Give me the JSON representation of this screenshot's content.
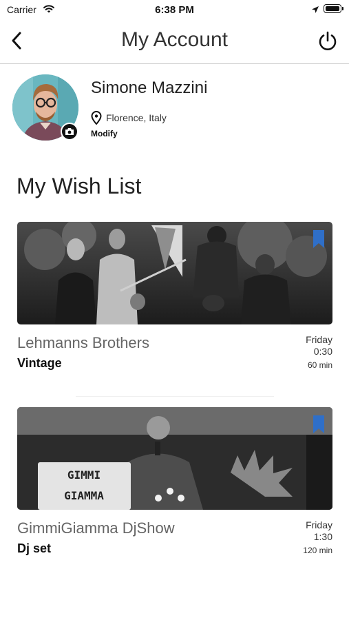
{
  "status_bar": {
    "carrier": "Carrier",
    "time": "6:38 PM"
  },
  "nav": {
    "title": "My Account",
    "back_icon": "chevron-left-icon",
    "power_icon": "power-icon"
  },
  "profile": {
    "name": "Simone Mazzini",
    "location": "Florence, Italy",
    "modify_label": "Modify",
    "avatar_bg": "#69b7c0",
    "camera_icon": "camera-icon",
    "pin_icon": "map-pin-icon"
  },
  "wishlist": {
    "title": "My Wish List",
    "bookmark_color": "#2f6fc8",
    "items": [
      {
        "title": "Lehmanns Brothers",
        "category": "Vintage",
        "day": "Friday",
        "time": "0:30",
        "duration": "60 min"
      },
      {
        "title": "GimmiGiamma DjShow",
        "category": "Dj set",
        "day": "Friday",
        "time": "1:30",
        "duration": "120 min",
        "sign_text": [
          "GIMMI",
          "GIAMMA"
        ]
      }
    ]
  }
}
